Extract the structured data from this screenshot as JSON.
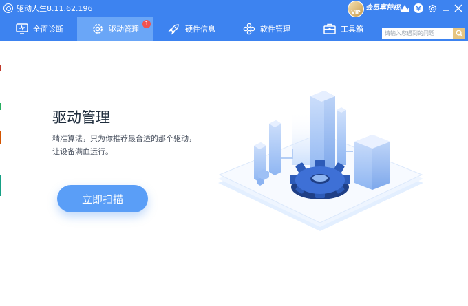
{
  "titlebar": {
    "title": "驱动人生8.11.62.196",
    "vip_badge_text": "VIP",
    "vip_text": "会员享特权",
    "icons": [
      "crown-icon",
      "coin-icon",
      "gear-icon",
      "minimize-icon",
      "close-icon"
    ]
  },
  "tabs": [
    {
      "label": "全面诊断",
      "icon": "monitor-icon",
      "active": false
    },
    {
      "label": "驱动管理",
      "icon": "gear-icon",
      "active": true,
      "badge": "1"
    },
    {
      "label": "硬件信息",
      "icon": "rocket-icon",
      "active": false
    },
    {
      "label": "软件管理",
      "icon": "apps-icon",
      "active": false
    },
    {
      "label": "工具箱",
      "icon": "toolbox-icon",
      "active": false
    }
  ],
  "search": {
    "placeholder": "请输入您遇到的问题"
  },
  "main": {
    "title": "驱动管理",
    "desc_line1": "精准算法，只为你推荐最合适的那个驱动，",
    "desc_line2": "让设备满血运行。",
    "scan_label": "立即扫描"
  },
  "colors": {
    "brand": "#3d83f0",
    "tab_active": "#6aa6f7",
    "button": "#5a9ef7",
    "badge": "#f05350"
  }
}
